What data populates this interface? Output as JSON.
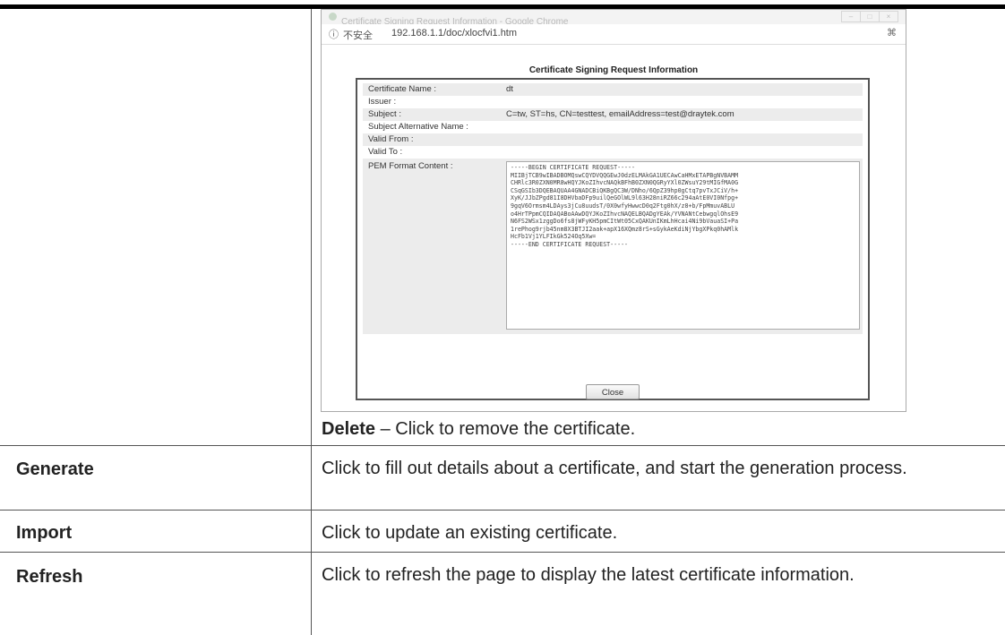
{
  "browser": {
    "window_title": "Certificate Signing Request Information - Google Chrome",
    "security_label": "不安全",
    "url": "192.168.1.1/doc/xlocfvi1.htm"
  },
  "dialog": {
    "title": "Certificate Signing Request Information",
    "fields": [
      {
        "label": "Certificate Name :",
        "value": "dt"
      },
      {
        "label": "Issuer :",
        "value": ""
      },
      {
        "label": "Subject :",
        "value": "C=tw, ST=hs, CN=testtest, emailAddress=test@draytek.com"
      },
      {
        "label": "Subject Alternative Name :",
        "value": ""
      },
      {
        "label": "Valid From :",
        "value": ""
      },
      {
        "label": "Valid To :",
        "value": ""
      }
    ],
    "pem_label": "PEM Format Content :",
    "pem_content": "-----BEGIN CERTIFICATE REQUEST-----\nMIIBjTCB9wIBADBOMQswCQYDVQQGEwJ0dzELMAkGA1UECAwCaHMxETAPBgNVBAMM\nCHRlc3R0ZXN0MR8wHQYJKoZIhvcNAQkBFhB0ZXN0QGRyYXl0ZWsuY29tMIGfMA0G\nCSqGSIb3DQEBAQUAA4GNADCBiQKBgQC3W/DNho/6QpZ39hp0gCtq7pvTxJCiV/h+\nXyK/JJbZPgd81I8DHVbaDFp9uilQeGOlWL9l63H28niRZ66c294aAtE0VI0Nfpg+\n9gqV6Ormsm4LDAys3jCu8uudsT/0X0wfyHwwcD0q2Ftg0hX/z8+b/FpMmuvABLU\no4HrTPpmCQIDAQABoAAwDQYJKoZIhvcNAQELBQADgYEAk/YVNANtCebwgqlOhsE9\nN6FS2WSx1zggDo6fs8jWFyKH5pmCItWt05CxQAKUnIKmLhHcai4Ni9bVauaSI+Pa\n1rePhog9rjb45nm8X3BTJI2aak+apX16XQmz8rS+sGykAeKdiNjYbgXPkq0hAMlk\nHcFb1Vj1YLFIkGk524Oq5Xw=\n-----END CERTIFICATE REQUEST-----",
    "close_label": "Close"
  },
  "delete_line": {
    "term": "Delete",
    "text": " – Click to remove the certificate."
  },
  "rows": [
    {
      "term": "Generate",
      "desc": "Click to fill out details about a certificate, and start the generation process."
    },
    {
      "term": "Import",
      "desc": "Click to update an existing certificate."
    },
    {
      "term": "Refresh",
      "desc": "Click to refresh the page to display the latest certificate information."
    }
  ]
}
